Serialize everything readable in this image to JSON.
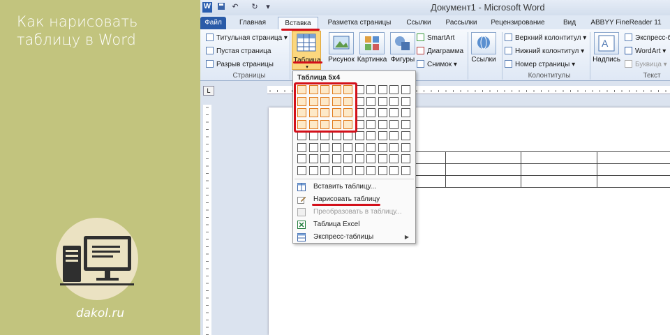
{
  "article": {
    "title": "Как нарисовать таблицу в Word",
    "site": "dakol.ru"
  },
  "window": {
    "title": "Документ1 - Microsoft Word"
  },
  "tabs": [
    "Файл",
    "Главная",
    "Вставка",
    "Разметка страницы",
    "Ссылки",
    "Рассылки",
    "Рецензирование",
    "Вид",
    "ABBYY FineReader 11"
  ],
  "ribbon": {
    "pages": {
      "items": [
        "Титульная страница",
        "Пустая страница",
        "Разрыв страницы"
      ],
      "group": "Страницы"
    },
    "table_label": "Таблица",
    "illustrations": {
      "picture": "Рисунок",
      "clipart": "Картинка",
      "shapes": "Фигуры",
      "smartart": "SmartArt",
      "chart": "Диаграмма",
      "screenshot": "Снимок"
    },
    "links": "Ссылки",
    "header_footer": {
      "items": [
        "Верхний колонтитул",
        "Нижний колонтитул",
        "Номер страницы"
      ],
      "group": "Колонтитулы"
    },
    "text": {
      "textbox": "Надпись",
      "items": [
        "Экспресс-б",
        "WordArt",
        "Буквица"
      ],
      "group": "Текст"
    }
  },
  "dropdown": {
    "title": "Таблица 5x4",
    "grid": {
      "cols": 10,
      "rows": 8,
      "selected_cols": 5,
      "selected_rows": 4
    },
    "items": [
      {
        "label": "Вставить таблицу...",
        "icon": "insert-table-icon",
        "enabled": true
      },
      {
        "label": "Нарисовать таблицу",
        "icon": "pencil-icon",
        "enabled": true
      },
      {
        "label": "Преобразовать в таблицу...",
        "icon": "convert-table-icon",
        "enabled": false
      },
      {
        "label": "Таблица Excel",
        "icon": "excel-icon",
        "enabled": true
      },
      {
        "label": "Экспресс-таблицы",
        "icon": "quick-tables-icon",
        "enabled": true
      }
    ]
  },
  "colors": {
    "left_panel": "#c2c47e",
    "highlight": "#d3101a",
    "grid_selected": "#e07a1c"
  }
}
